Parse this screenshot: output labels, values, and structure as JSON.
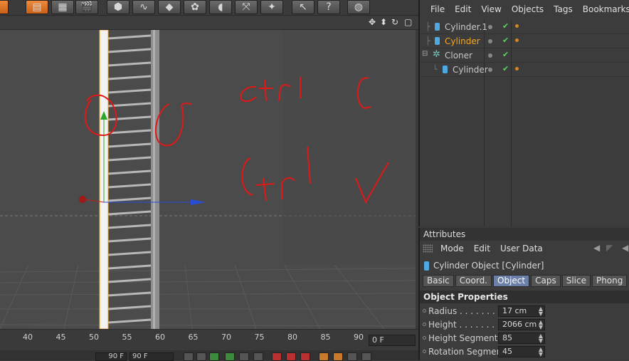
{
  "toolbar": {
    "icons": [
      "render-icon",
      "render-settings-icon",
      "film-icon",
      "cube-icon",
      "spline-icon",
      "nurbs-icon",
      "mograph-icon",
      "deformer-icon",
      "scene-icon",
      "effector-icon",
      "select-arrow-icon",
      "help-icon",
      "globe-icon"
    ]
  },
  "viewport": {
    "handwriting": [
      "ctrl C",
      "ctrl V"
    ],
    "nav_icons": [
      "move-icon",
      "zoom-icon",
      "rotate-icon",
      "maximize-icon"
    ]
  },
  "timeline": {
    "ticks": [
      "40",
      "45",
      "50",
      "55",
      "60",
      "65",
      "70",
      "75",
      "80",
      "85",
      "90"
    ],
    "current_frame": "0 F",
    "end_frame_a": "90 F",
    "end_frame_b": "90 F"
  },
  "objects_panel": {
    "menu": [
      "File",
      "Edit",
      "View",
      "Objects",
      "Tags",
      "Bookmarks"
    ],
    "rows": [
      {
        "name": "Cylinder.1",
        "selected": false
      },
      {
        "name": "Cylinder",
        "selected": true
      },
      {
        "name": "Cloner",
        "selected": false
      },
      {
        "name": "Cylinder",
        "selected": false
      }
    ]
  },
  "attributes": {
    "title": "Attributes",
    "menu": [
      "Mode",
      "Edit",
      "User Data"
    ],
    "object_label": "Cylinder Object [Cylinder]",
    "tabs": [
      "Basic",
      "Coord.",
      "Object",
      "Caps",
      "Slice",
      "Phong"
    ],
    "active_tab": "Object",
    "section": "Object Properties",
    "props": [
      {
        "label": "Radius . . . . . . . . .",
        "value": "17 cm"
      },
      {
        "label": "Height . . . . . . . . .",
        "value": "2066 cm"
      },
      {
        "label": "Height Segments",
        "value": "85"
      },
      {
        "label": "Rotation Segments",
        "value": "45"
      }
    ]
  },
  "colors": {
    "accent_selected": "#f5a623",
    "active_tab": "#6b7fa8",
    "annotation": "#e01818"
  }
}
